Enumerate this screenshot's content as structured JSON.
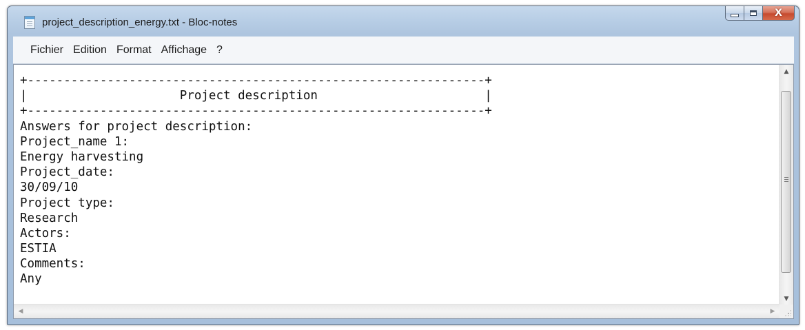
{
  "window": {
    "title": "project_description_energy.txt - Bloc-notes",
    "app_icon": "notepad-icon",
    "controls": {
      "minimize_icon": "minimize-icon",
      "maximize_icon": "maximize-icon",
      "close_icon": "close-icon",
      "close_glyph": "X"
    }
  },
  "menu": {
    "items": [
      {
        "label": "Fichier"
      },
      {
        "label": "Edition"
      },
      {
        "label": "Format"
      },
      {
        "label": "Affichage"
      },
      {
        "label": "?"
      }
    ]
  },
  "document": {
    "lines": [
      "+---------------------------------------------------------------+",
      "|                     Project description                       |",
      "+---------------------------------------------------------------+",
      "Answers for project description:",
      "Project_name 1:",
      "Energy harvesting",
      "Project_date:",
      "30/09/10",
      "Project type:",
      "Research",
      "Actors:",
      "ESTIA",
      "Comments:",
      "Any"
    ]
  },
  "scrollbars": {
    "up_glyph": "▲",
    "down_glyph": "▼",
    "left_glyph": "◀",
    "right_glyph": "▶"
  },
  "colors": {
    "frame": "#b7cde5",
    "close_button": "#c64a2e",
    "menu_background": "#f4f6f9",
    "text": "#111111"
  }
}
